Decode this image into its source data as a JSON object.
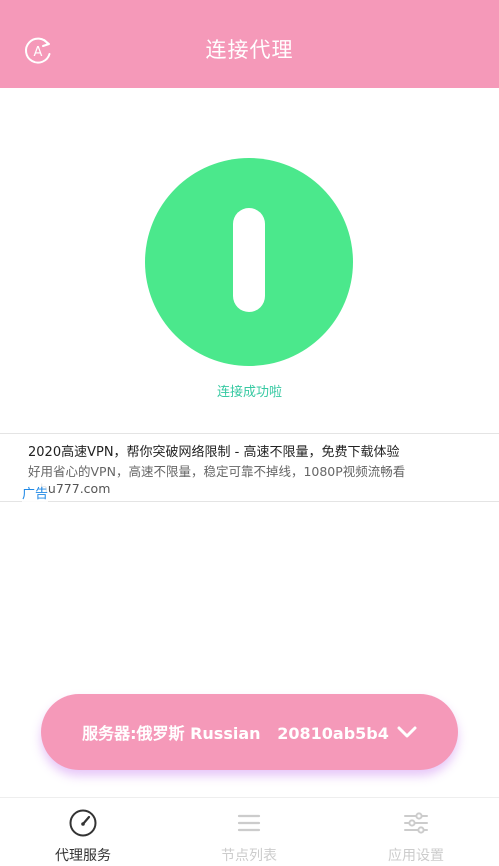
{
  "app_bar": {
    "title": "连接代理"
  },
  "connection": {
    "status_text": "连接成功啦"
  },
  "ad": {
    "title": "2020高速VPN，帮你突破网络限制 - 高速不限量，免费下载体验",
    "description": "好用省心的VPN，高速不限量，稳定可靠不掉线，1080P视频流畅看",
    "tag": "广告",
    "url": "hu777.com"
  },
  "server_selector": {
    "label": "服务器:俄罗斯 Russian   20810ab5b4"
  },
  "tabs": [
    {
      "label": "代理服务",
      "icon": "speedometer-icon",
      "active": true
    },
    {
      "label": "节点列表",
      "icon": "list-icon",
      "active": false
    },
    {
      "label": "应用设置",
      "icon": "sliders-icon",
      "active": false
    }
  ],
  "colors": {
    "accent_pink": "#f599b9",
    "power_green": "#4be88c",
    "status_teal": "#36c9a2",
    "ad_tag_blue": "#1e88e5"
  }
}
